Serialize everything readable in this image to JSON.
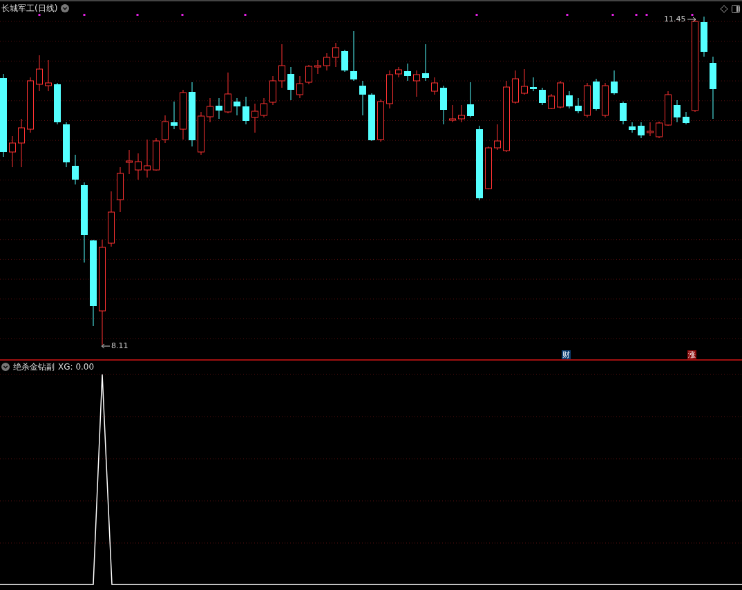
{
  "main_chart": {
    "title": "长城军工(日线)",
    "high_label": "11.45",
    "low_label": "8.11",
    "badges": [
      {
        "text": "财",
        "kind": "finance"
      },
      {
        "text": "涨",
        "kind": "limit_up"
      }
    ]
  },
  "indicator_panel": {
    "name": "绝杀金钻副",
    "reading": "XG: 0.00"
  }
}
